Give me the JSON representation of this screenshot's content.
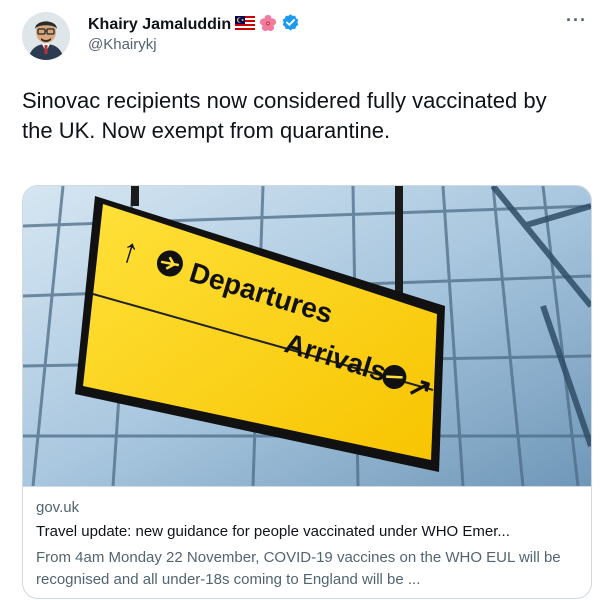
{
  "author": {
    "name": "Khairy Jamaluddin",
    "handle": "@Khairykj",
    "flag_icon": "malaysia-flag-icon",
    "flower_icon": "hibiscus-icon",
    "verified_icon": "verified-badge-icon"
  },
  "tweet": {
    "text": "Sinovac recipients now considered fully vaccinated by the UK. Now exempt from quarantine."
  },
  "card": {
    "image": {
      "sign_departures": "Departures",
      "sign_arrivals": "Arrivals"
    },
    "domain": "gov.uk",
    "title": "Travel update: new guidance for people vaccinated under WHO Emer...",
    "description": "From 4am Monday 22 November, COVID-19 vaccines on the WHO EUL will be recognised and all under-18s coming to England will be ..."
  },
  "colors": {
    "text_primary": "#0f1419",
    "text_secondary": "#536471",
    "verified_blue": "#1d9bf0",
    "sign_yellow": "#ffd21f",
    "border": "#cfd9de"
  }
}
